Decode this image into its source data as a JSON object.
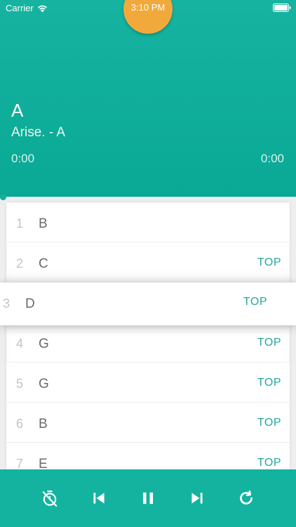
{
  "status_bar": {
    "carrier": "Carrier",
    "time": "3:10 PM"
  },
  "now_playing": {
    "title": "A",
    "subtitle": "Arise. - A",
    "elapsed": "0:00",
    "total": "0:00",
    "progress": 0
  },
  "playlist": [
    {
      "num": "1",
      "name": "B",
      "action": ""
    },
    {
      "num": "2",
      "name": "C",
      "action": "TOP"
    },
    {
      "num": "3",
      "name": "D",
      "action": "TOP"
    },
    {
      "num": "4",
      "name": "G",
      "action": "TOP"
    },
    {
      "num": "5",
      "name": "G",
      "action": "TOP"
    },
    {
      "num": "6",
      "name": "B",
      "action": "TOP"
    },
    {
      "num": "7",
      "name": "E",
      "action": "TOP"
    }
  ],
  "controls": [
    "timer-off-icon",
    "skip-previous-icon",
    "pause-icon",
    "skip-next-icon",
    "repeat-icon"
  ],
  "colors": {
    "accent": "#13b39f",
    "time_bubble": "#f2a93b",
    "action_text": "#26a69a"
  }
}
